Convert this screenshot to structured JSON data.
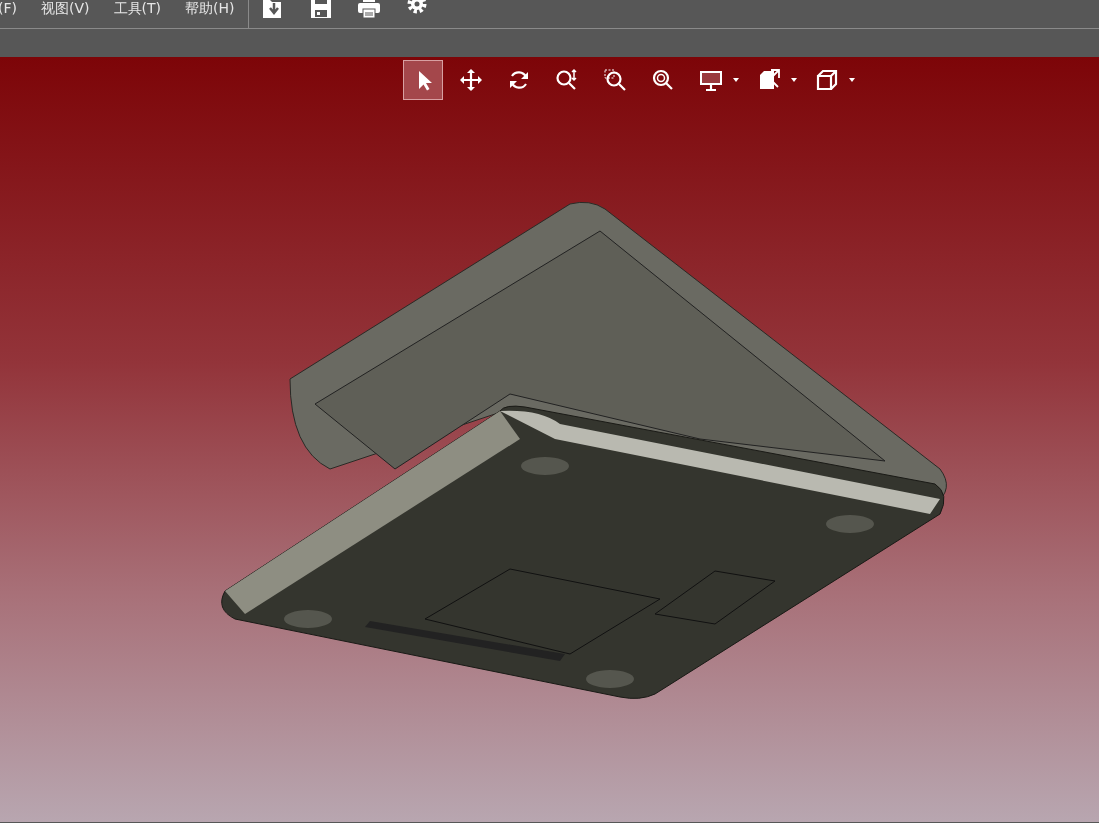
{
  "menu": [
    {
      "label": "(F)"
    },
    {
      "label": "视图(V)"
    },
    {
      "label": "工具(T)"
    },
    {
      "label": "帮助(H)"
    }
  ],
  "quick_tools": [
    {
      "kind": "import"
    },
    {
      "kind": "save"
    },
    {
      "kind": "print"
    },
    {
      "kind": "settings"
    }
  ],
  "view_tools": [
    {
      "kind": "select",
      "selected": true,
      "dropdown": false
    },
    {
      "kind": "pan",
      "selected": false,
      "dropdown": false
    },
    {
      "kind": "rotate",
      "selected": false,
      "dropdown": false
    },
    {
      "kind": "zoom",
      "selected": false,
      "dropdown": false
    },
    {
      "kind": "zoom-window",
      "selected": false,
      "dropdown": false
    },
    {
      "kind": "zoom-fit",
      "selected": false,
      "dropdown": false
    },
    {
      "kind": "display",
      "selected": false,
      "dropdown": true
    },
    {
      "kind": "section",
      "selected": false,
      "dropdown": true
    },
    {
      "kind": "view-cube",
      "selected": false,
      "dropdown": true
    }
  ]
}
